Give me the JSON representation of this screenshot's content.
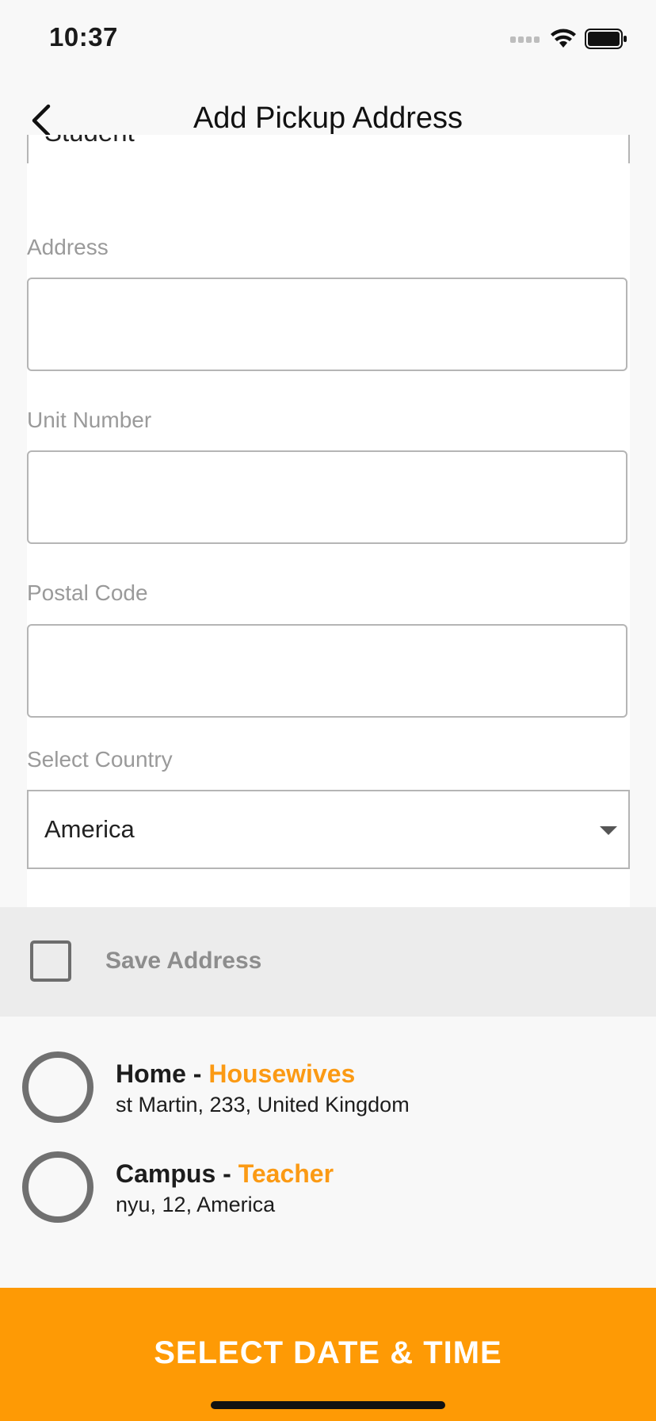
{
  "status_bar": {
    "time": "10:37"
  },
  "nav": {
    "title": "Add Pickup Address"
  },
  "form": {
    "partial_field_value": "Student",
    "address_label": "Address",
    "address_value": "",
    "unit_label": "Unit Number",
    "unit_value": "",
    "postal_label": "Postal Code",
    "postal_value": "",
    "country_label": "Select Country",
    "country_value": "America"
  },
  "save": {
    "label": "Save Address",
    "checked": false
  },
  "saved_addresses": [
    {
      "name": "Home - ",
      "type": "Housewives",
      "detail": "st Martin, 233, United Kingdom"
    },
    {
      "name": "Campus - ",
      "type": "Teacher",
      "detail": "nyu, 12, America"
    }
  ],
  "cta": {
    "label": "SELECT DATE & TIME"
  },
  "colors": {
    "accent": "#fe9a05",
    "type_text": "#fb9a14"
  }
}
